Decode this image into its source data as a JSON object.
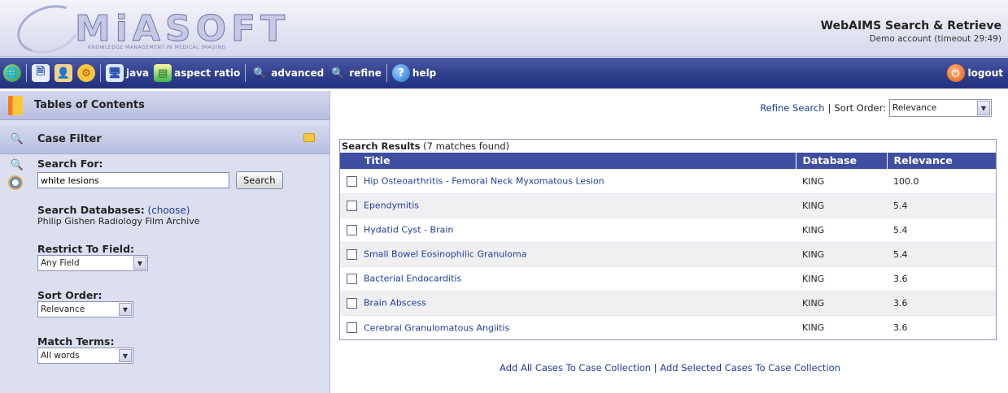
{
  "header": {
    "logo_text": "MiASOFT",
    "logo_tagline": "KNOWLEDGE MANAGEMENT IN MEDICAL IMAGING",
    "app_title": "WebAIMS Search & Retrieve",
    "account": "Demo account (timeout 29:49)"
  },
  "toolbar": {
    "java_label": "java",
    "aspect_label": "aspect ratio",
    "advanced_label": "advanced",
    "refine_label": "refine",
    "help_label": "help",
    "logout_label": "logout"
  },
  "sidebar": {
    "toc_title": "Tables of Contents",
    "filter_title": "Case Filter",
    "search_for_label": "Search For:",
    "search_value": "white lesions",
    "search_button": "Search",
    "databases_label": "Search Databases:",
    "databases_choose": "(choose)",
    "databases_value": "Philip Gishen Radiology Film Archive",
    "restrict_label": "Restrict To Field:",
    "restrict_value": "Any Field",
    "sort_label": "Sort Order:",
    "sort_value": "Relevance",
    "match_label": "Match Terms:",
    "match_value": "All words"
  },
  "main": {
    "refine_link": "Refine Search",
    "sep": "|",
    "sort_label": "Sort Order:",
    "sort_value": "Relevance",
    "results_title": "Search Results",
    "results_count": "(7 matches found)",
    "columns": {
      "title": "Title",
      "database": "Database",
      "relevance": "Relevance"
    },
    "rows": [
      {
        "title": "Hip Osteoarthritis - Femoral Neck Myxomatous Lesion",
        "database": "KING",
        "relevance": "100.0"
      },
      {
        "title": "Ependymitis",
        "database": "KING",
        "relevance": "5.4"
      },
      {
        "title": "Hydatid Cyst - Brain",
        "database": "KING",
        "relevance": "5.4"
      },
      {
        "title": "Small Bowel Eosinophilic Granuloma",
        "database": "KING",
        "relevance": "5.4"
      },
      {
        "title": "Bacterial Endocarditis",
        "database": "KING",
        "relevance": "3.6"
      },
      {
        "title": "Brain Abscess",
        "database": "KING",
        "relevance": "3.6"
      },
      {
        "title": "Cerebral Granulomatous Angiitis",
        "database": "KING",
        "relevance": "3.6"
      }
    ],
    "add_all": "Add All Cases To Case Collection",
    "add_selected": "Add Selected Cases To Case Collection"
  },
  "icons": {
    "toolbar": [
      "globe-icon",
      "document-icon",
      "person-icon",
      "gear-icon",
      "monitor-icon",
      "chart-icon",
      "magnifier-icon",
      "help-icon",
      "power-icon"
    ]
  },
  "colors": {
    "toolbar": "#2f3f8c",
    "table_header": "#3e4ea0",
    "link": "#213c9c",
    "sidebar": "#dcdff0"
  }
}
